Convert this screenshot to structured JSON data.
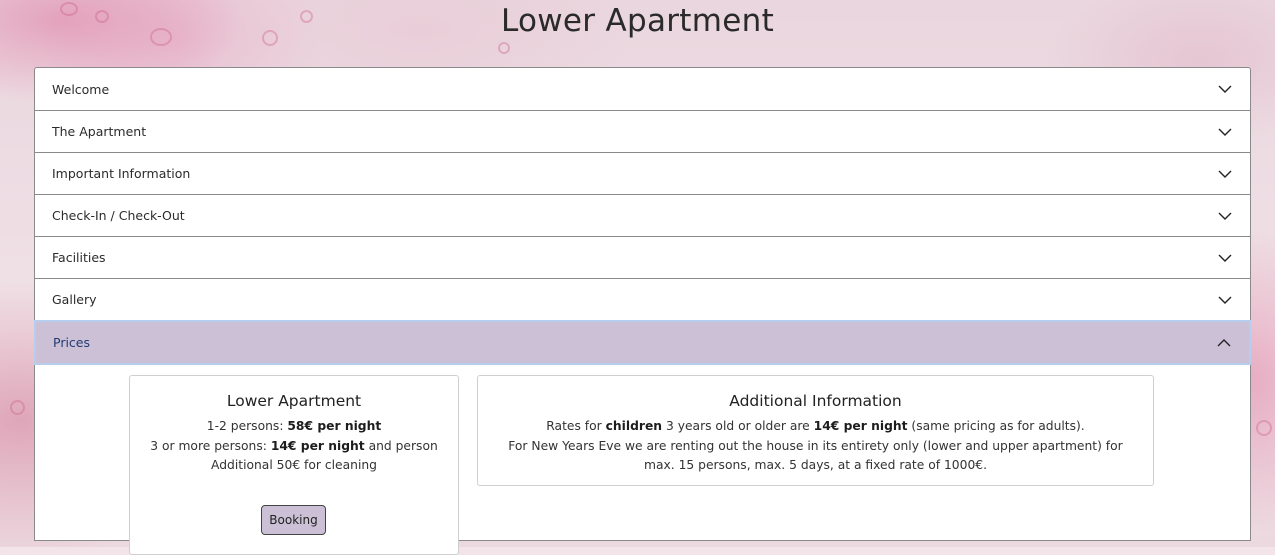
{
  "page": {
    "title": "Lower Apartment"
  },
  "accordion": {
    "items": [
      {
        "label": "Welcome",
        "expanded": false
      },
      {
        "label": "The Apartment",
        "expanded": false
      },
      {
        "label": "Important Information",
        "expanded": false
      },
      {
        "label": "Check-In / Check-Out",
        "expanded": false
      },
      {
        "label": "Facilities",
        "expanded": false
      },
      {
        "label": "Gallery",
        "expanded": false
      },
      {
        "label": "Prices",
        "expanded": true
      }
    ],
    "icons": {
      "collapsed": "chevron-down-icon",
      "expanded": "chevron-up-icon"
    }
  },
  "prices": {
    "apartment_card": {
      "title": "Lower Apartment",
      "line1_prefix": "1-2 persons: ",
      "line1_bold": "58€ per night",
      "line2_prefix": "3 or more persons: ",
      "line2_bold": "14€ per night",
      "line2_suffix": " and person",
      "line3": "Additional 50€ for cleaning",
      "booking_label": "Booking"
    },
    "info_card": {
      "title": "Additional Information",
      "line1_a": "Rates for ",
      "line1_b": "children",
      "line1_c": " 3 years old or older are ",
      "line1_d": "14€ per night",
      "line1_e": " (same pricing as for adults).",
      "line2": "For New Years Eve we are renting out the house in its entirety only (lower and upper apartment) for max. 15 persons, max. 5 days, at a fixed rate of 1000€."
    }
  },
  "colors": {
    "active_header": "#ccc0d6",
    "active_border": "#b6cdee",
    "booking_button": "#ccc0d6",
    "active_text": "#213a73"
  }
}
